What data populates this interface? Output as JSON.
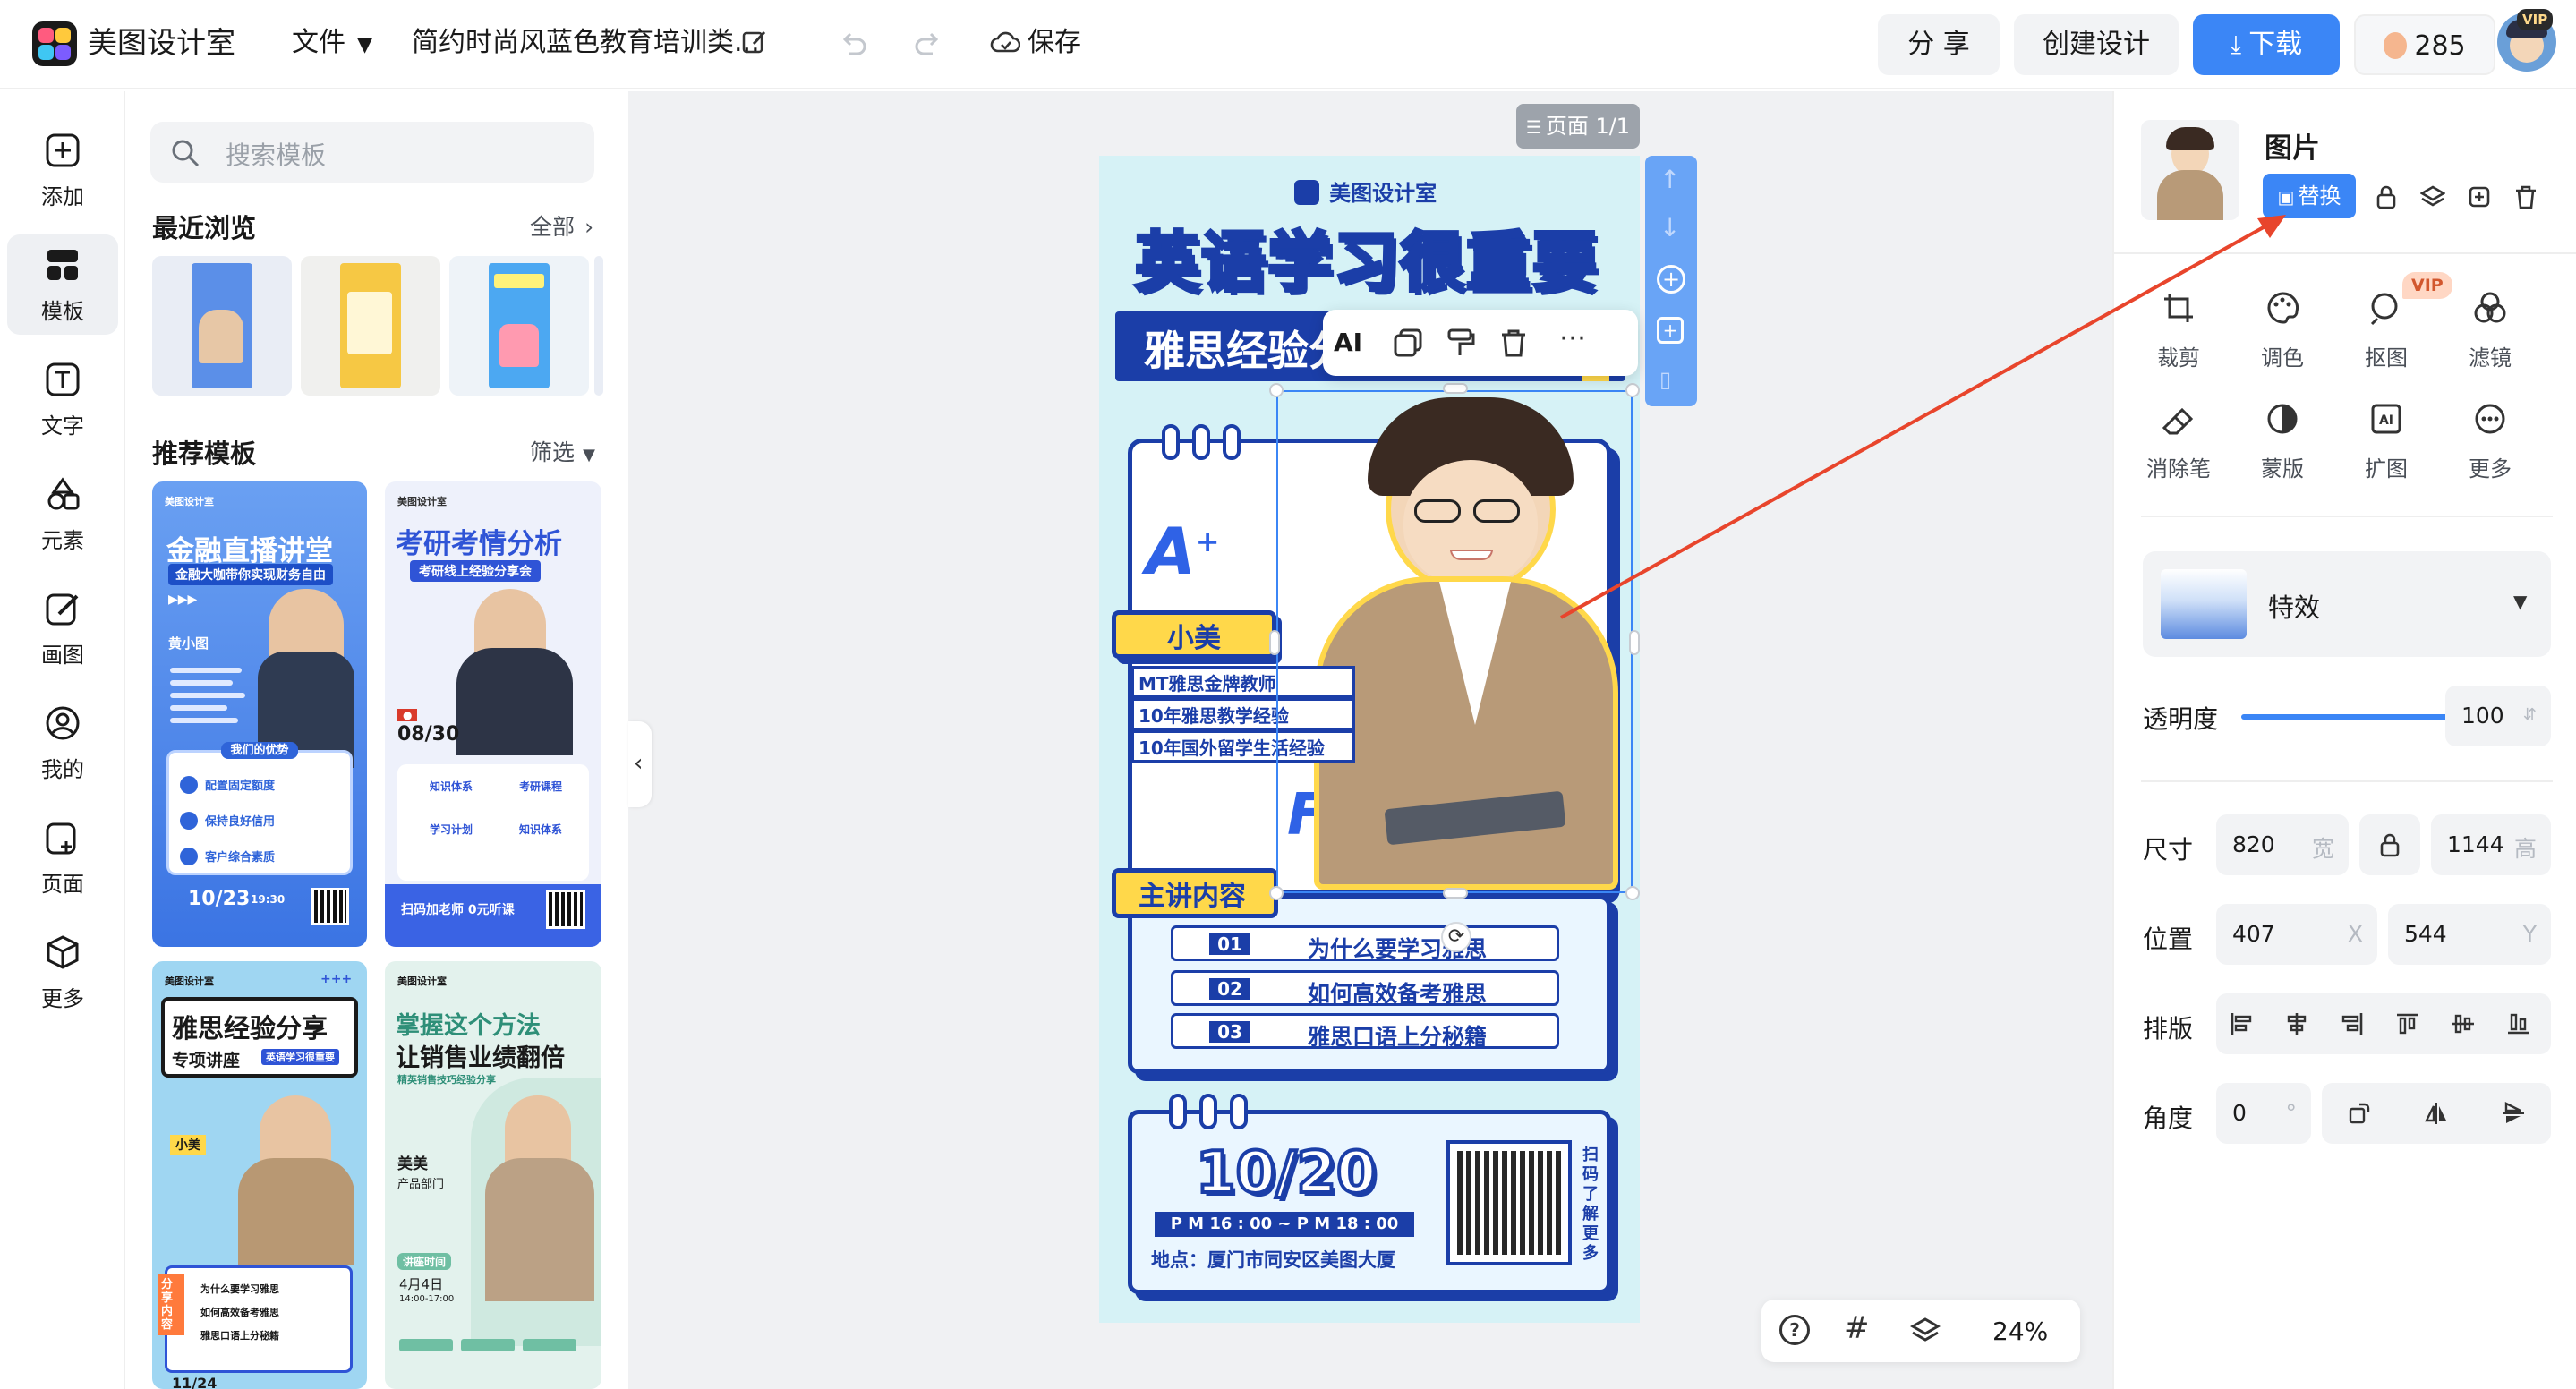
{
  "topbar": {
    "brand": "美图设计室",
    "file_menu": "文件",
    "doc_title": "简约时尚风蓝色教育培训类...",
    "save": "保存",
    "share": "分 享",
    "create": "创建设计",
    "download": "下载",
    "coins": "285",
    "vip": "VIP"
  },
  "rail": {
    "items": [
      {
        "label": "添加",
        "icon": "plus-square-icon"
      },
      {
        "label": "模板",
        "icon": "template-grid-icon"
      },
      {
        "label": "文字",
        "icon": "text-t-icon"
      },
      {
        "label": "元素",
        "icon": "shapes-icon"
      },
      {
        "label": "画图",
        "icon": "pen-icon"
      },
      {
        "label": "我的",
        "icon": "user-icon"
      },
      {
        "label": "页面",
        "icon": "page-add-icon"
      },
      {
        "label": "更多",
        "icon": "box-icon"
      }
    ]
  },
  "panel": {
    "search_placeholder": "搜索模板",
    "recent_title": "最近浏览",
    "recent_all": "全部",
    "recommend_title": "推荐模板",
    "filter": "筛选",
    "recent_thumbs": [
      {
        "bg": "#5b8fe8"
      },
      {
        "bg": "#f6c844"
      },
      {
        "bg": "#4ca8f2"
      }
    ],
    "cards": [
      {
        "brand": "美图设计室",
        "title": "金融直播讲堂",
        "subtitle": "金融大咖带你实现财务自由",
        "name": "黄小图",
        "date": "10/23",
        "time": "19:30",
        "advantage": "我们的优势",
        "items": [
          "配置固定额度",
          "保持良好信用",
          "客户综合素质"
        ]
      },
      {
        "brand": "美图设计室",
        "title": "考研考情分析",
        "subtitle": "考研线上经验分享会",
        "date": "08/30",
        "items": [
          "知识体系",
          "考研课程",
          "学习计划",
          "知识体系"
        ],
        "footer": "扫码加老师 0元听课"
      },
      {
        "brand": "美图设计室",
        "title": "雅思经验分享",
        "subtitle": "专项讲座",
        "tag": "英语学习很重要",
        "name": "小美",
        "side": "分享内容",
        "items": [
          "为什么要学习雅思",
          "如何高效备考雅思",
          "雅思口语上分秘籍"
        ],
        "date": "11/24"
      },
      {
        "brand": "美图设计室",
        "title": "掌握这个方法",
        "title2": "让销售业绩翻倍",
        "subtitle": "精英销售技巧经验分享",
        "name": "美美",
        "dept": "产品部门",
        "date_label": "讲座时间",
        "date": "4月4日",
        "time": "14:00-17:00"
      }
    ]
  },
  "canvas": {
    "page_indicator": "页面 1/1",
    "zoom": "24%",
    "float_toolbar": {
      "ai": "AI"
    },
    "poster": {
      "brand": "美图设计室",
      "title": "英语学习很重要",
      "subtitle": "雅思经验分享",
      "teacher_name": "小美",
      "teacher_lines": [
        "MT雅思金牌教师",
        "10年雅思教学经验",
        "10年国外留学生活经验"
      ],
      "content_label": "主讲内容",
      "rows": [
        {
          "num": "01",
          "text": "为什么要学习雅思"
        },
        {
          "num": "02",
          "text": "如何高效备考雅思"
        },
        {
          "num": "03",
          "text": "雅思口语上分秘籍"
        }
      ],
      "date": "10/20",
      "time": "P M 16 : 00 ~ P M 18 : 00",
      "address": "地点：厦门市同安区美图大厦",
      "qr_caption": "扫码了解更多"
    }
  },
  "rpanel": {
    "title": "图片",
    "replace": "替换",
    "tools": [
      {
        "label": "裁剪",
        "icon": "crop-icon"
      },
      {
        "label": "调色",
        "icon": "palette-icon"
      },
      {
        "label": "抠图",
        "icon": "cutout-icon"
      },
      {
        "label": "滤镜",
        "icon": "filter-icon"
      },
      {
        "label": "消除笔",
        "icon": "eraser-icon"
      },
      {
        "label": "蒙版",
        "icon": "mask-icon"
      },
      {
        "label": "扩图",
        "icon": "ai-expand-icon"
      },
      {
        "label": "更多",
        "icon": "more-icon"
      }
    ],
    "vip_badge": "VIP",
    "effect": "特效",
    "opacity_label": "透明度",
    "opacity": "100",
    "opacity_fraction": 1.0,
    "size_label": "尺寸",
    "width": "820",
    "width_unit": "宽",
    "height": "1144",
    "height_unit": "高",
    "pos_label": "位置",
    "x": "407",
    "x_unit": "X",
    "y": "544",
    "y_unit": "Y",
    "layout_label": "排版",
    "angle_label": "角度",
    "angle": "0",
    "angle_unit": "°"
  },
  "colors": {
    "accent": "#3b86f6",
    "poster_navy": "#1b3ea8",
    "poster_yellow": "#ffd84a",
    "annotation_arrow": "#e8452c"
  }
}
